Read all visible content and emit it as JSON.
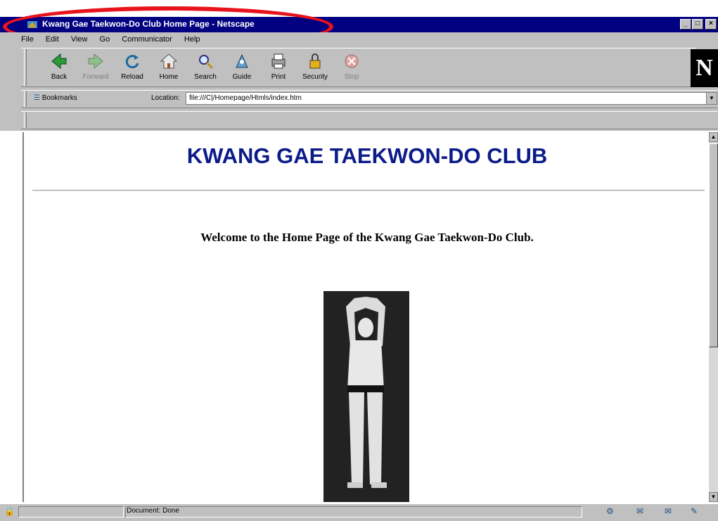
{
  "window": {
    "title": "Kwang Gae Taekwon-Do Club Home Page - Netscape"
  },
  "menu": [
    "File",
    "Edit",
    "View",
    "Go",
    "Communicator",
    "Help"
  ],
  "toolbar": [
    {
      "label": "Back",
      "icon": "back-arrow-icon",
      "enabled": true
    },
    {
      "label": "Forward",
      "icon": "forward-arrow-icon",
      "enabled": false
    },
    {
      "label": "Reload",
      "icon": "reload-icon",
      "enabled": true
    },
    {
      "label": "Home",
      "icon": "home-icon",
      "enabled": true
    },
    {
      "label": "Search",
      "icon": "search-icon",
      "enabled": true
    },
    {
      "label": "Guide",
      "icon": "guide-icon",
      "enabled": true
    },
    {
      "label": "Print",
      "icon": "print-icon",
      "enabled": true
    },
    {
      "label": "Security",
      "icon": "lock-icon",
      "enabled": true
    },
    {
      "label": "Stop",
      "icon": "stop-icon",
      "enabled": false
    }
  ],
  "location": {
    "bookmarks_label": "Bookmarks",
    "label": "Location:",
    "url": "file:///C|/Homepage/Htmls/index.htm"
  },
  "page": {
    "heading": "KWANG GAE TAEKWON-DO CLUB",
    "welcome": "Welcome to the Home Page of the Kwang Gae Taekwon-Do Club."
  },
  "status": {
    "text": "Document: Done"
  },
  "colors": {
    "title_bar": "#000080",
    "heading": "#0b1b8a",
    "highlight_circle": "#e8141c",
    "chrome": "#c0c0c0"
  }
}
